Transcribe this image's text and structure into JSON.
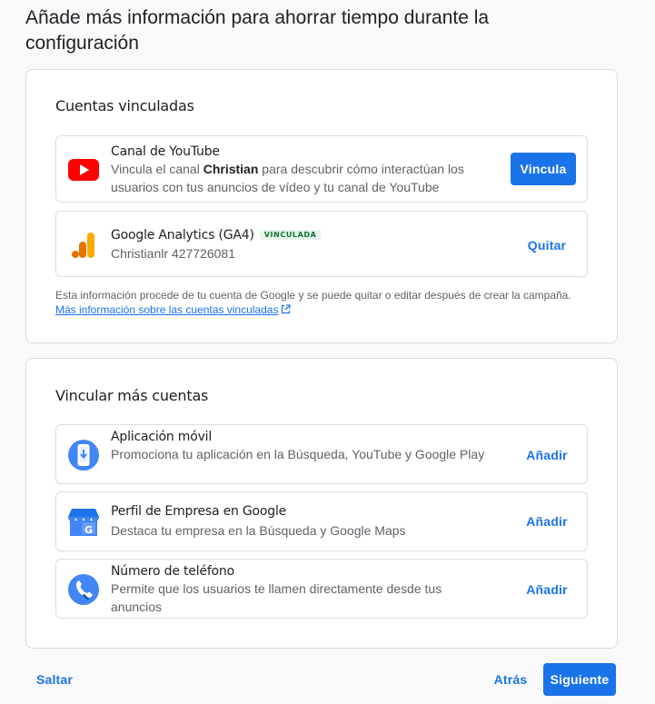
{
  "page": {
    "title": "Añade más información para ahorrar tiempo durante la configuración"
  },
  "linked": {
    "title": "Cuentas vinculadas",
    "youtube": {
      "title": "Canal de YouTube",
      "desc_prefix": "Vincula el canal ",
      "desc_channel": "Christian",
      "desc_suffix": " para descubrir cómo interactúan los usuarios con tus anuncios de vídeo y tu canal de YouTube",
      "button": "Vincula"
    },
    "analytics": {
      "title": "Google Analytics (GA4)",
      "badge": "VINCULADA",
      "account": "Christianlr 427726081",
      "button": "Quitar"
    },
    "footnote": "Esta información procede de tu cuenta de Google y se puede quitar o editar después de crear la campaña. ",
    "footnote_link": "Más información sobre las cuentas vinculadas"
  },
  "more": {
    "title": "Vincular más cuentas",
    "items": [
      {
        "title": "Aplicación móvil",
        "desc": "Promociona tu aplicación en la Búsqueda, YouTube y Google Play",
        "button": "Añadir"
      },
      {
        "title": "Perfil de Empresa en Google",
        "desc": "Destaca tu empresa en la Búsqueda y Google Maps",
        "button": "Añadir"
      },
      {
        "title": "Número de teléfono",
        "desc": "Permite que los usuarios te llamen directamente desde tus anuncios",
        "button": "Añadir"
      }
    ]
  },
  "footer": {
    "skip": "Saltar",
    "back": "Atrás",
    "next": "Siguiente"
  },
  "colors": {
    "accent": "#1a73e8",
    "youtube_red": "#ff0000",
    "analytics_orange": "#f9ab00",
    "badge_green": "#137333"
  }
}
